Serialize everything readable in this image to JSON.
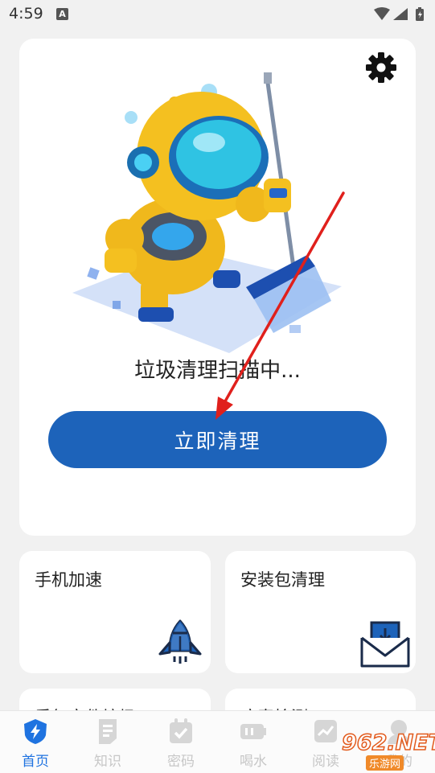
{
  "status_bar": {
    "time": "4:59",
    "notif_letter": "A"
  },
  "hero": {
    "scan_status": "垃圾清理扫描中...",
    "clean_button": "立即清理"
  },
  "tools": [
    {
      "title": "手机加速",
      "icon": "rocket-icon"
    },
    {
      "title": "安装包清理",
      "icon": "download-mail-icon"
    },
    {
      "title": "重复文件垃圾",
      "icon": "file-icon"
    },
    {
      "title": "病毒检测",
      "icon": "shield-icon"
    }
  ],
  "nav": [
    {
      "label": "首页",
      "icon": "lightning-shield-icon",
      "active": true
    },
    {
      "label": "知识",
      "icon": "document-icon"
    },
    {
      "label": "密码",
      "icon": "calendar-check-icon"
    },
    {
      "label": "喝水",
      "icon": "battery-icon"
    },
    {
      "label": "阅读",
      "icon": "chart-icon"
    },
    {
      "label": "我的",
      "icon": "user-icon"
    }
  ],
  "watermark": {
    "number": "962.NET",
    "subtitle": "乐游网"
  },
  "colors": {
    "accent": "#1d63ba",
    "active_nav": "#1f73e0",
    "robot_yellow": "#f0b81c",
    "arrow_red": "#e0201c"
  }
}
